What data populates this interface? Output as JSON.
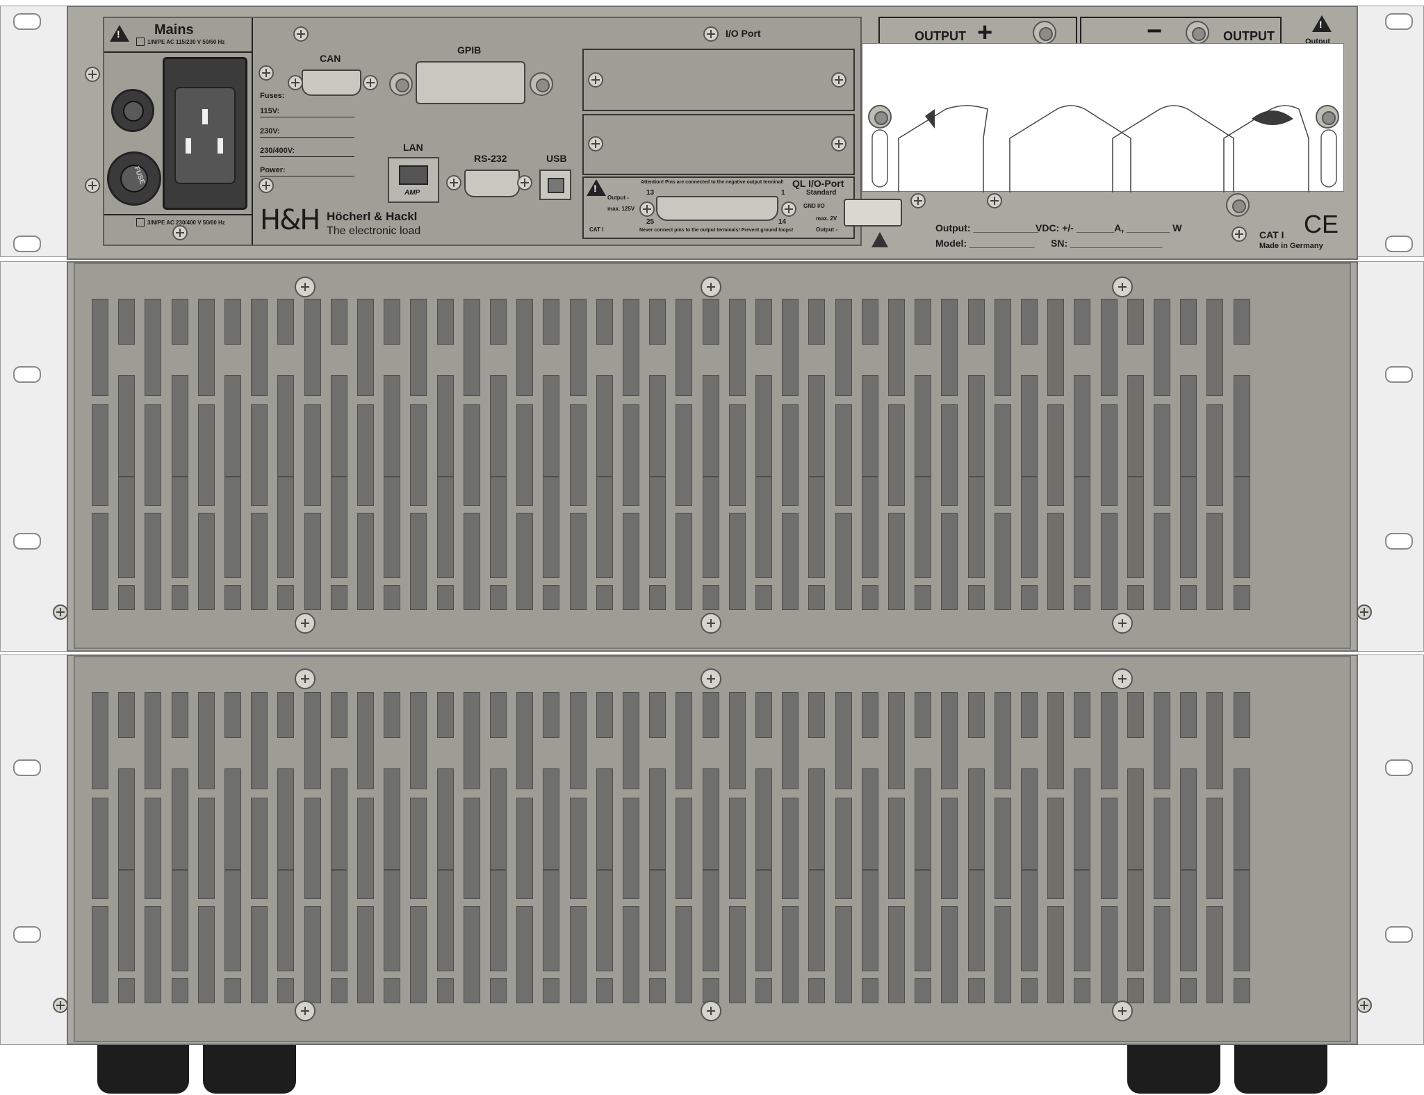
{
  "mains": {
    "title": "Mains",
    "rating_1ph": "1/N/PE AC 115/230 V 50/60 Hz",
    "rating_3ph": "3/N/PE AC 230/400 V 50/60 Hz",
    "fuse_text": "FUSE"
  },
  "fuses": {
    "title": "Fuses:",
    "v115": "115V:",
    "v230": "230V:",
    "v230_400": "230/400V:",
    "power": "Power:"
  },
  "ports": {
    "can": "CAN",
    "gpib": "GPIB",
    "lan": "LAN",
    "rs232": "RS-232",
    "usb": "USB",
    "io_port": "I/O Port",
    "amp": "AMP"
  },
  "brand": {
    "logo": "H&H",
    "company": "Höcherl & Hackl",
    "tagline": "The electronic load"
  },
  "ql_io": {
    "title": "QL  I/O-Port",
    "subtitle": "Standard",
    "attention": "Attention! Pins are connected to the negative output terminal!",
    "never": "Never connect pins to the output terminals! Prevent ground loops!",
    "pin13": "13",
    "pin1": "1",
    "pin25": "25",
    "pin14": "14",
    "output_minus": "Output -",
    "max125": "max. 125V",
    "cat": "CAT I",
    "gnd_io": "GND I/O",
    "max2v": "max. 2V",
    "output_minus2": "Output -"
  },
  "output": {
    "plus_label": "OUTPUT",
    "plus_sign": "+",
    "minus_sign": "−",
    "minus_label": "OUTPUT",
    "corner_label": "Output"
  },
  "rating_plate": {
    "output": "Output: ____________",
    "vdc": "VDC: +/- _______A, ________ W",
    "model": "Model: ____________",
    "sn": "SN: _________________",
    "cat": "CAT I",
    "made": "Made in Germany",
    "ce": "CE"
  }
}
